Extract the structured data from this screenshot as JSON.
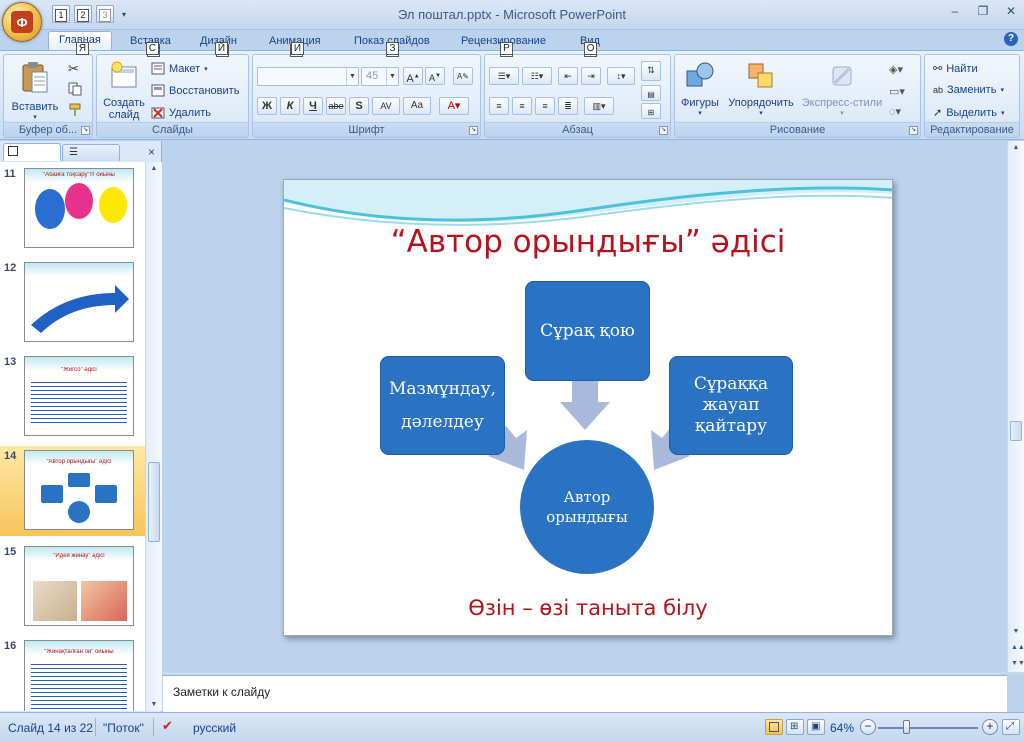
{
  "window": {
    "title": "Эл поштал.pptx - Microsoft PowerPoint"
  },
  "quick_access": {
    "keys": [
      "1",
      "2",
      "3"
    ]
  },
  "tabs": [
    {
      "label": "Главная",
      "key": "Я",
      "active": true
    },
    {
      "label": "Вставка",
      "key": "С"
    },
    {
      "label": "Дизайн",
      "key": "Й"
    },
    {
      "label": "Анимация",
      "key": "И"
    },
    {
      "label": "Показ слайдов",
      "key": "З"
    },
    {
      "label": "Рецензирование",
      "key": "Р"
    },
    {
      "label": "Вид",
      "key": "О"
    }
  ],
  "ribbon": {
    "clipboard": {
      "label": "Буфер об...",
      "paste": "Вставить"
    },
    "slides": {
      "label": "Слайды",
      "new_slide_line1": "Создать",
      "new_slide_line2": "слайд",
      "layout": "Макет",
      "reset": "Восстановить",
      "delete": "Удалить"
    },
    "font": {
      "label": "Шрифт",
      "size": "45",
      "bold": "Ж",
      "italic": "К",
      "underline": "Ч",
      "strike": "abe",
      "shadow": "S",
      "spacing": "AV",
      "case": "Aa"
    },
    "paragraph": {
      "label": "Абзац"
    },
    "drawing": {
      "label": "Рисование",
      "shapes": "Фигуры",
      "arrange": "Упорядочить",
      "quick_styles": "Экспресс-стили"
    },
    "editing": {
      "label": "Редактирование",
      "find": "Найти",
      "replace": "Заменить",
      "select": "Выделить"
    }
  },
  "thumbnails": [
    {
      "num": "11",
      "title": "“Абайға тоқсару”!!! ойыны"
    },
    {
      "num": "12",
      "title": ""
    },
    {
      "num": "13",
      "title": "“Жигсо” әдісі"
    },
    {
      "num": "14",
      "title": "“Автор орындығы” әдісі",
      "selected": true
    },
    {
      "num": "15",
      "title": "“Идея жинау” әдісі"
    },
    {
      "num": "16",
      "title": "“Жинақталған ой” ойыны"
    }
  ],
  "slide": {
    "title": "“Автор орындығы” әдісі",
    "box_top": "Сұрақ қою",
    "box_left_line1": "Мазмұндау,",
    "box_left_line2": "дәлелдеу",
    "box_right_line1": "Сұраққа",
    "box_right_line2": "жауап",
    "box_right_line3": "қайтару",
    "circle_line1": "Автор",
    "circle_line2": "орындығы",
    "footer": "Өзін – өзі таныта білу",
    "colors": {
      "box": "#2a73c3",
      "title": "#b5121b",
      "arrow": "#a9b9dc"
    }
  },
  "notes": {
    "placeholder": "Заметки к слайду"
  },
  "status": {
    "slide_info": "Слайд 14 из 22",
    "theme": "\"Поток\"",
    "language": "русский",
    "zoom": "64%"
  }
}
